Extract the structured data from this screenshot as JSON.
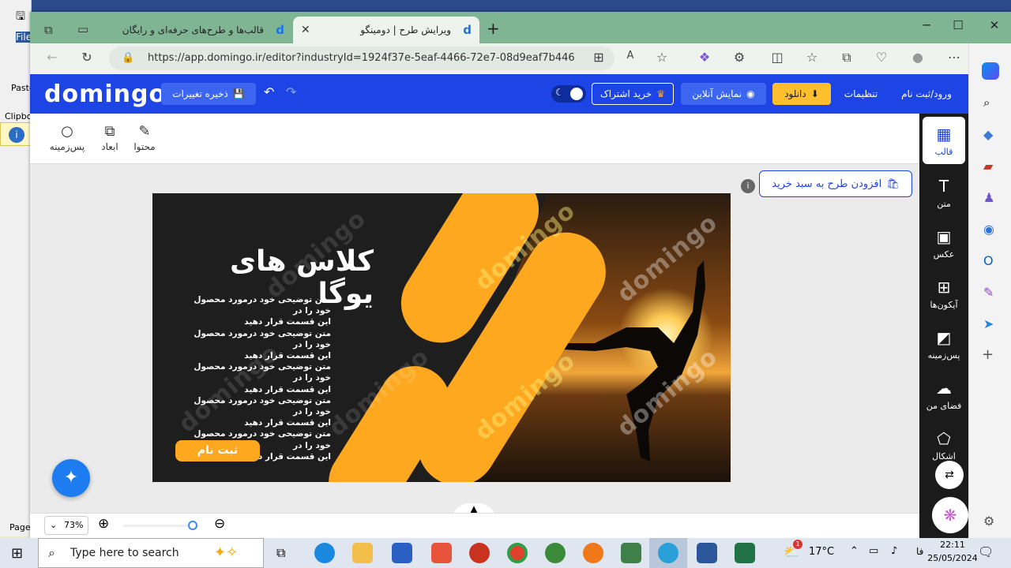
{
  "browser": {
    "tabs": [
      {
        "title": "قالب‌ها و طرح‌های حرفه‌ای و رایگان"
      },
      {
        "title": "ویرایش طرح | دومینگو"
      }
    ],
    "url": "https://app.domingo.ir/editor?industryId=1924f37e-5eaf-4466-72e7-08d9eaf7b446",
    "window_controls": {
      "minimize": "─",
      "maximize": "☐",
      "close": "✕"
    }
  },
  "background_app": {
    "file": "File",
    "paste": "Paste",
    "clipboard": "Clipbo",
    "page": "Page"
  },
  "header": {
    "logo": "domingo",
    "save_label": "ذخیره تغییرات",
    "login_label": "ورود/ثبت نام",
    "settings_label": "تنظیمات",
    "download_label": "دانلود",
    "preview_label": "نمایش آنلاین",
    "subscribe_label": "خرید اشتراک"
  },
  "toolbar": {
    "content_label": "محتوا",
    "dimensions_label": "ابعاد",
    "background_label": "پس‌زمینه"
  },
  "workspace": {
    "add_to_cart_label": "افزودن طرح به سبد خرید",
    "zoom_value": "73%"
  },
  "sidebar": {
    "items": [
      {
        "label": "قالب",
        "icon": "template-icon"
      },
      {
        "label": "متن",
        "icon": "text-icon"
      },
      {
        "label": "عکس",
        "icon": "image-icon"
      },
      {
        "label": "آیکون‌ها",
        "icon": "icons-icon"
      },
      {
        "label": "پس‌زمینه",
        "icon": "background-icon"
      },
      {
        "label": "فضای من",
        "icon": "cloud-icon"
      },
      {
        "label": "اشکال",
        "icon": "shapes-icon"
      }
    ]
  },
  "design": {
    "title": "کلاس های یوگا",
    "body_lines": [
      "متن توضیحی خود درمورد محصول خود را در",
      "این قسمت قرار دهید",
      "متن توضیحی خود درمورد محصول خود را در",
      "این قسمت قرار دهید",
      "متن توضیحی خود درمورد محصول خود را در",
      "این قسمت قرار دهید",
      "متن توضیحی خود درمورد محصول خود را در",
      "این قسمت قرار دهید",
      "متن توضیحی خود درمورد محصول خود را در",
      "این قسمت قرار دهید"
    ],
    "cta_label": "ثبت نام",
    "watermark": "domingo",
    "colors": {
      "bg": "#1e1e1e",
      "accent": "#fda81f"
    }
  },
  "taskbar": {
    "search_placeholder": "Type here to search",
    "weather": "17°C",
    "lang": "فا",
    "time": "22:11",
    "date": "25/05/2024",
    "badge": "1"
  }
}
